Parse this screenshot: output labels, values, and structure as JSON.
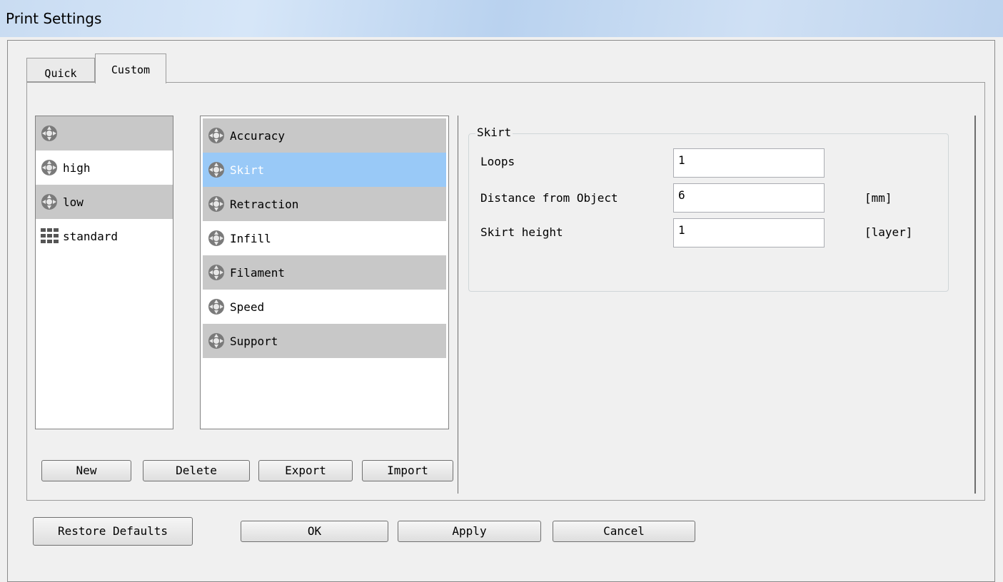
{
  "window": {
    "title": "Print Settings"
  },
  "tabs": [
    {
      "label": "Quick"
    },
    {
      "label": "Custom"
    }
  ],
  "profiles": {
    "items": [
      {
        "label": "",
        "icon": "gear-icon"
      },
      {
        "label": "high",
        "icon": "gear-icon"
      },
      {
        "label": "low",
        "icon": "gear-icon"
      },
      {
        "label": "standard",
        "icon": "grid-icon"
      }
    ],
    "buttons": {
      "new": "New",
      "delete": "Delete",
      "export": "Export",
      "import": "Import"
    }
  },
  "categories": {
    "items": [
      {
        "label": "Accuracy"
      },
      {
        "label": "Skirt"
      },
      {
        "label": "Retraction"
      },
      {
        "label": "Infill"
      },
      {
        "label": "Filament"
      },
      {
        "label": "Speed"
      },
      {
        "label": "Support"
      }
    ],
    "selected": "Skirt"
  },
  "skirt": {
    "title": "Skirt",
    "loops": {
      "label": "Loops",
      "value": "1",
      "unit": ""
    },
    "distance": {
      "label": "Distance from Object",
      "value": "6",
      "unit": "[mm]"
    },
    "height": {
      "label": "Skirt height",
      "value": "1",
      "unit": "[layer]"
    }
  },
  "footer": {
    "restore": "Restore Defaults",
    "ok": "OK",
    "apply": "Apply",
    "cancel": "Cancel"
  },
  "colors": {
    "selected": "#99c9f7",
    "row_gray": "#c8c8c8"
  }
}
